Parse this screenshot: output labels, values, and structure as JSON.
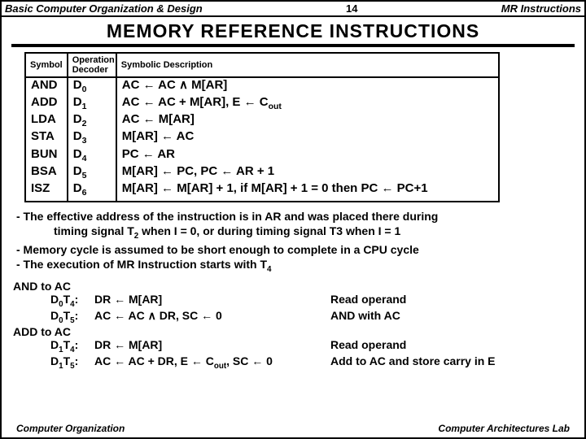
{
  "header": {
    "left": "Basic Computer Organization & Design",
    "page": "14",
    "right": "MR Instructions"
  },
  "title": "MEMORY  REFERENCE  INSTRUCTIONS",
  "table": {
    "head": {
      "c1": "Symbol",
      "c2": "Operation Decoder",
      "c3": "Symbolic Description"
    },
    "rows": [
      {
        "sym": "AND",
        "dec_base": "D",
        "dec_sub": "0",
        "desc": "AC ←  AC ∧ M[AR]"
      },
      {
        "sym": "ADD",
        "dec_base": "D",
        "dec_sub": "1",
        "desc": "AC ←  AC + M[AR], E ← Cout"
      },
      {
        "sym": "LDA",
        "dec_base": "D",
        "dec_sub": "2",
        "desc": "AC ←  M[AR]"
      },
      {
        "sym": "STA",
        "dec_base": "D",
        "dec_sub": "3",
        "desc": "M[AR] ←  AC"
      },
      {
        "sym": "BUN",
        "dec_base": "D",
        "dec_sub": "4",
        "desc": "PC ←  AR"
      },
      {
        "sym": "BSA",
        "dec_base": "D",
        "dec_sub": "5",
        "desc": "M[AR] ←  PC, PC ← AR + 1"
      },
      {
        "sym": "ISZ",
        "dec_base": "D",
        "dec_sub": "6",
        "desc": "M[AR] ←  M[AR] + 1, if M[AR] + 1 = 0 then PC ← PC+1"
      }
    ]
  },
  "notes": {
    "l1": "- The effective address of the instruction is in AR and was placed there during",
    "l1b": "timing signal T2 when I = 0, or during timing signal T3 when I = 1",
    "l2": "- Memory cycle is assumed to be short enough to complete in a CPU cycle",
    "l3": "- The execution of MR Instruction starts with T4"
  },
  "exec": {
    "and_head": "AND to AC",
    "and_r1": {
      "lbl": "D0T4:",
      "expr": "DR ← M[AR]",
      "cmt": "Read operand"
    },
    "and_r2": {
      "lbl": "D0T5:",
      "expr": "AC ← AC ∧ DR, SC ← 0",
      "cmt": "AND with AC"
    },
    "add_head": "ADD to AC",
    "add_r1": {
      "lbl": "D1T4:",
      "expr": "DR ← M[AR]",
      "cmt": "Read operand"
    },
    "add_r2": {
      "lbl": "D1T5:",
      "expr": "AC ← AC + DR, E ← Cout, SC ← 0",
      "cmt": "Add to AC and store carry in E"
    }
  },
  "footer": {
    "left": "Computer Organization",
    "right": "Computer Architectures Lab"
  }
}
